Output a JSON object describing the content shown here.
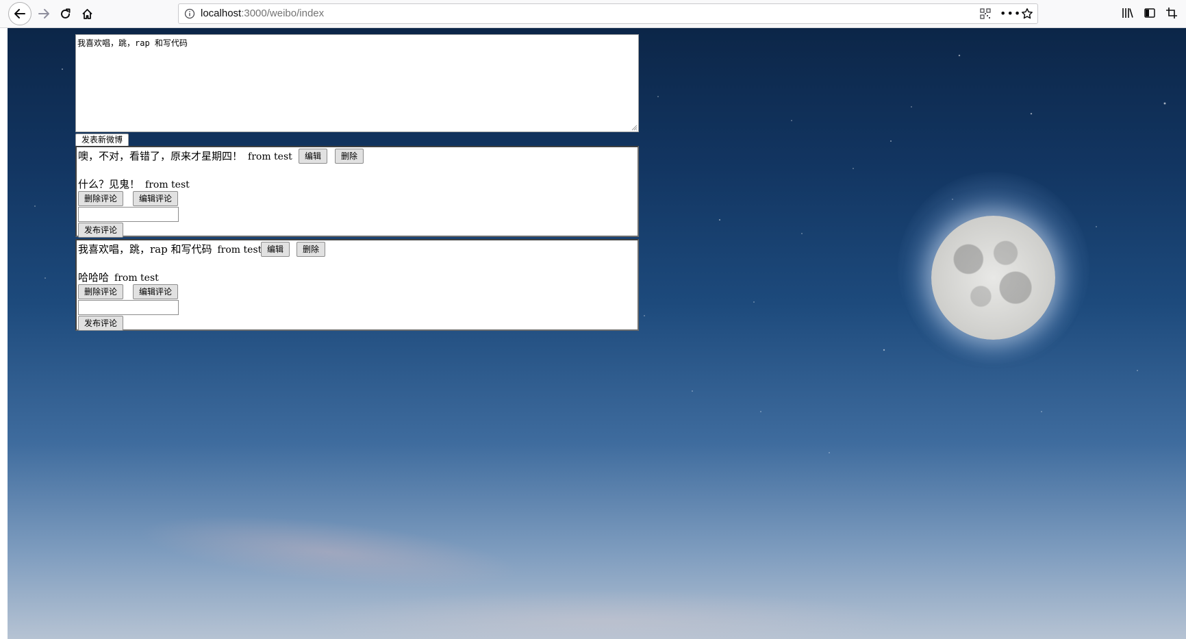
{
  "browser": {
    "url_host": "localhost",
    "url_path": ":3000/weibo/index"
  },
  "composer": {
    "text": "我喜欢唱，跳，rap 和写代码",
    "post_label": "发表新微博"
  },
  "posts": [
    {
      "content": "噢，不对，看错了，原来才星期四！",
      "author": "from test",
      "edit_label": "编辑",
      "delete_label": "删除",
      "comment": {
        "content": "什么？见鬼！",
        "author": "from test"
      },
      "delete_comment_label": "删除评论",
      "edit_comment_label": "编辑评论",
      "comment_input": "",
      "publish_comment_label": "发布评论"
    },
    {
      "content": "我喜欢唱，跳，rap 和写代码",
      "author": "from test",
      "edit_label": "编辑",
      "delete_label": "删除",
      "comment": {
        "content": "哈哈哈",
        "author": "from test"
      },
      "delete_comment_label": "删除评论",
      "edit_comment_label": "编辑评论",
      "comment_input": "",
      "publish_comment_label": "发布评论"
    }
  ],
  "icons": [
    "back-icon",
    "forward-icon",
    "reload-icon",
    "home-icon",
    "info-icon",
    "qr-code-icon",
    "more-icon",
    "bookmark-star-icon",
    "library-icon",
    "sidebar-icon",
    "screenshot-icon",
    "moon"
  ],
  "colors": {
    "sky_top": "#0c2648",
    "sky_bottom": "#b6c3d3",
    "toolbar": "#f9f9fa"
  }
}
